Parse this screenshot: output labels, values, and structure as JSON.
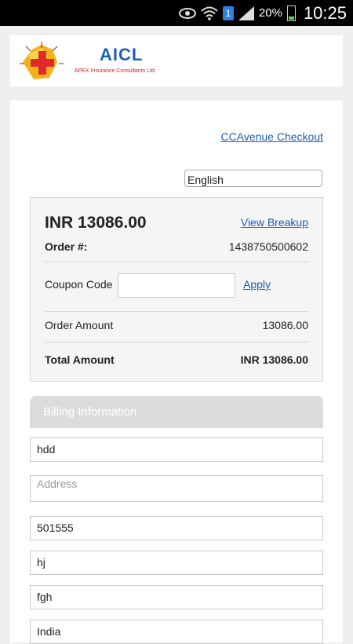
{
  "status_bar": {
    "sim_label": "1",
    "battery_pct": "20%",
    "time": "10:25"
  },
  "header": {
    "brand": "AICL",
    "brand_sub": "APEX Insurance Consultants Ltd."
  },
  "checkout": {
    "checkout_link": "CCAvenue Checkout",
    "language": "English"
  },
  "order": {
    "amount_display": "INR 13086.00",
    "view_breakup": "View Breakup",
    "order_label": "Order #:",
    "order_number": "1438750500602",
    "coupon_label": "Coupon Code",
    "coupon_value": "",
    "apply_label": "Apply",
    "order_amount_label": "Order  Amount",
    "order_amount_value": "13086.00",
    "total_label": "Total Amount",
    "total_value": "INR 13086.00"
  },
  "billing": {
    "header": "Billing Information",
    "name_value": "hdd",
    "address_placeholder": "Address",
    "zip_value": "501555",
    "city_value": "hj",
    "state_value": "fgh",
    "country_value": "India"
  },
  "colors": {
    "link": "#1a5fb4",
    "brand": "#1d5fb8",
    "billing_header_bg": "#dcdcdc"
  }
}
